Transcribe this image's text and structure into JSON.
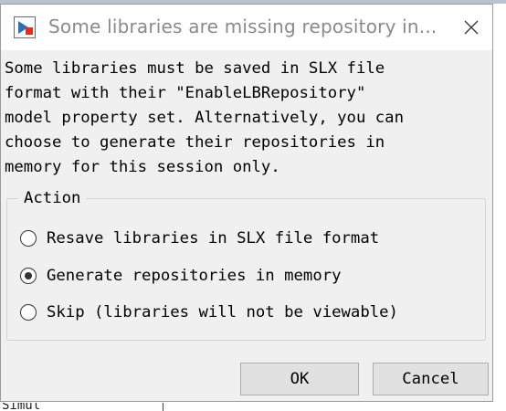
{
  "dialog": {
    "title": "Some libraries are missing repository in...",
    "message": "Some libraries must be saved in SLX file\nformat with their \"EnableLBRepository\"\nmodel property set. Alternatively, you can\nchoose to generate their repositories in\nmemory for this session only.",
    "group_title": "Action",
    "options": [
      {
        "label": "Resave libraries in SLX file format",
        "selected": false
      },
      {
        "label": "Generate repositories in memory",
        "selected": true
      },
      {
        "label": "Skip (libraries will not be viewable)",
        "selected": false
      }
    ],
    "ok_label": "OK",
    "cancel_label": "Cancel",
    "icon": "simulink-app-icon",
    "close_icon": "close-icon"
  },
  "background": {
    "partial_text": "Simul"
  },
  "colors": {
    "title_text": "#8a8a8a",
    "dialog_bg": "#f0f0f0",
    "button_bg": "#e1e1e1",
    "icon_red": "#e0301e",
    "icon_blue": "#2f6fb5"
  }
}
